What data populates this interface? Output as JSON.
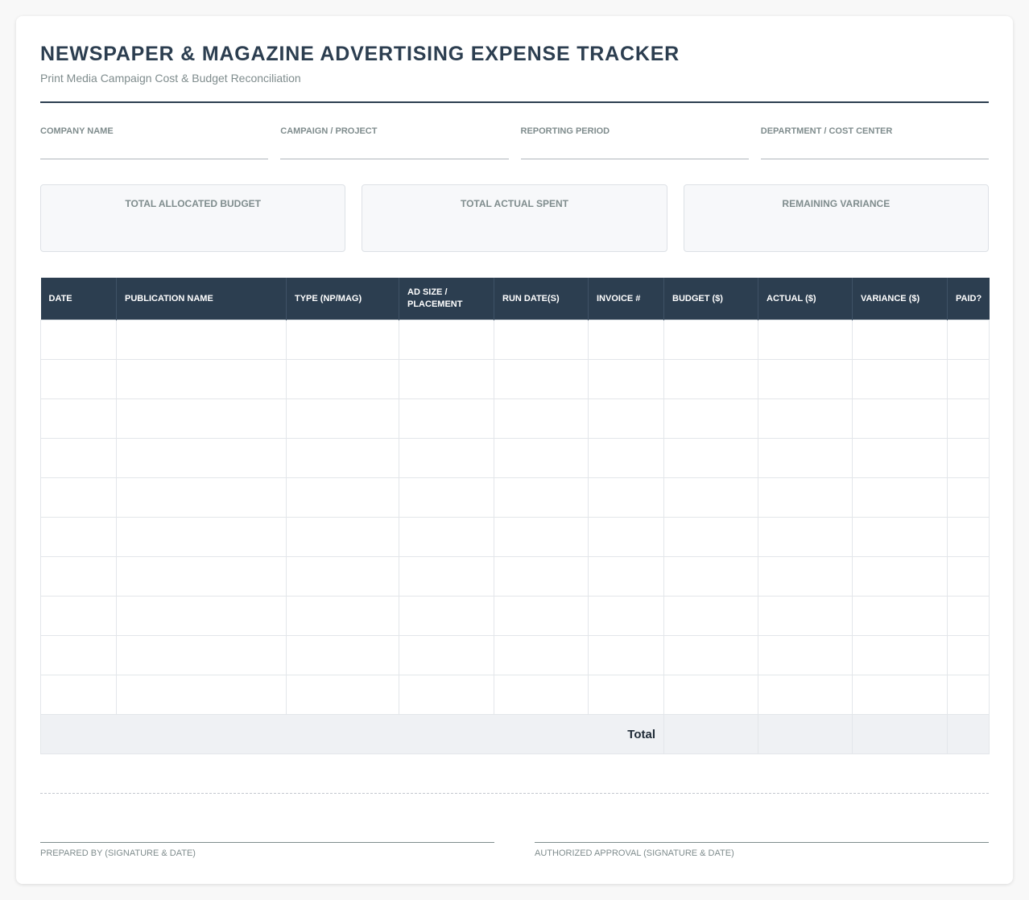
{
  "header": {
    "title": "NEWSPAPER & MAGAZINE ADVERTISING EXPENSE TRACKER",
    "subtitle": "Print Media Campaign Cost & Budget Reconciliation"
  },
  "fields": [
    {
      "label": "COMPANY NAME",
      "value": ""
    },
    {
      "label": "CAMPAIGN / PROJECT",
      "value": ""
    },
    {
      "label": "REPORTING PERIOD",
      "value": ""
    },
    {
      "label": "DEPARTMENT / COST CENTER",
      "value": ""
    }
  ],
  "summary": [
    {
      "label": "TOTAL ALLOCATED BUDGET",
      "value": ""
    },
    {
      "label": "TOTAL ACTUAL SPENT",
      "value": ""
    },
    {
      "label": "REMAINING VARIANCE",
      "value": ""
    }
  ],
  "table": {
    "columns": [
      "DATE",
      "PUBLICATION NAME",
      "TYPE (NP/MAG)",
      "AD SIZE / PLACEMENT",
      "RUN DATE(S)",
      "INVOICE #",
      "BUDGET ($)",
      "ACTUAL ($)",
      "VARIANCE ($)",
      "PAID?"
    ],
    "rows": [
      [
        "",
        "",
        "",
        "",
        "",
        "",
        "",
        "",
        "",
        ""
      ],
      [
        "",
        "",
        "",
        "",
        "",
        "",
        "",
        "",
        "",
        ""
      ],
      [
        "",
        "",
        "",
        "",
        "",
        "",
        "",
        "",
        "",
        ""
      ],
      [
        "",
        "",
        "",
        "",
        "",
        "",
        "",
        "",
        "",
        ""
      ],
      [
        "",
        "",
        "",
        "",
        "",
        "",
        "",
        "",
        "",
        ""
      ],
      [
        "",
        "",
        "",
        "",
        "",
        "",
        "",
        "",
        "",
        ""
      ],
      [
        "",
        "",
        "",
        "",
        "",
        "",
        "",
        "",
        "",
        ""
      ],
      [
        "",
        "",
        "",
        "",
        "",
        "",
        "",
        "",
        "",
        ""
      ],
      [
        "",
        "",
        "",
        "",
        "",
        "",
        "",
        "",
        "",
        ""
      ],
      [
        "",
        "",
        "",
        "",
        "",
        "",
        "",
        "",
        "",
        ""
      ]
    ],
    "total_label": "Total",
    "totals": {
      "budget": "",
      "actual": "",
      "variance": "",
      "paid": ""
    }
  },
  "signatures": {
    "prepared_by": "PREPARED BY (SIGNATURE & DATE)",
    "approval": "AUTHORIZED APPROVAL (SIGNATURE & DATE)"
  }
}
